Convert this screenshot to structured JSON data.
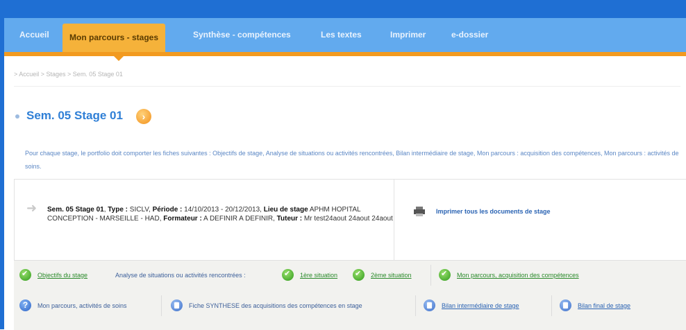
{
  "nav": {
    "items": [
      "Accueil",
      "Mon parcours - stages",
      "Synthèse - compétences",
      "Les textes",
      "Imprimer",
      "e-dossier"
    ]
  },
  "breadcrumb": "> Accueil > Stages > Sem. 05 Stage 01",
  "page": {
    "title": "Sem. 05 Stage 01",
    "intro": "Pour chaque stage, le portfolio doit comporter les fiches suivantes : Objectifs de stage, Analyse de situations ou activités rencontrées, Bilan intermédiaire de stage, Mon parcours : acquisition des compétences, Mon parcours : activités de soins."
  },
  "stage": {
    "name": "Sem. 05 Stage 01",
    "type_label": "Type :",
    "type_value": "SICLV,",
    "periode_label": "Période :",
    "periode_value": "14/10/2013 - 20/12/2013,",
    "lieu_label": "Lieu de stage",
    "lieu_value": "APHM HOPITAL CONCEPTION - MARSEILLE - HAD,",
    "formateur_label": "Formateur :",
    "formateur_value": "A DEFINIR A DEFINIR,",
    "tuteur_label": "Tuteur :",
    "tuteur_value": "Mr test24aout 24aout 24aout"
  },
  "print_link": "Imprimer tous les documents de stage",
  "actions": {
    "row1": {
      "objectifs": "Objectifs du stage",
      "analyse": "Analyse de situations ou activités rencontrées :",
      "situation1": "1ère situation",
      "situation2": "2ème situation",
      "acquisition": "Mon parcours, acquisition des compétences"
    },
    "row2": {
      "activites": "Mon parcours, activités de soins",
      "synthese": "Fiche SYNTHESE des acquisitions des compétences en stage",
      "bilan_inter": "Bilan intermédiaire de stage",
      "bilan_final": "Bilan final de stage"
    }
  },
  "colors": {
    "nav_bg": "#62aaee",
    "nav_active": "#f5b23a",
    "accent_orange": "#f29a1f",
    "title_blue": "#2f7fd6"
  }
}
